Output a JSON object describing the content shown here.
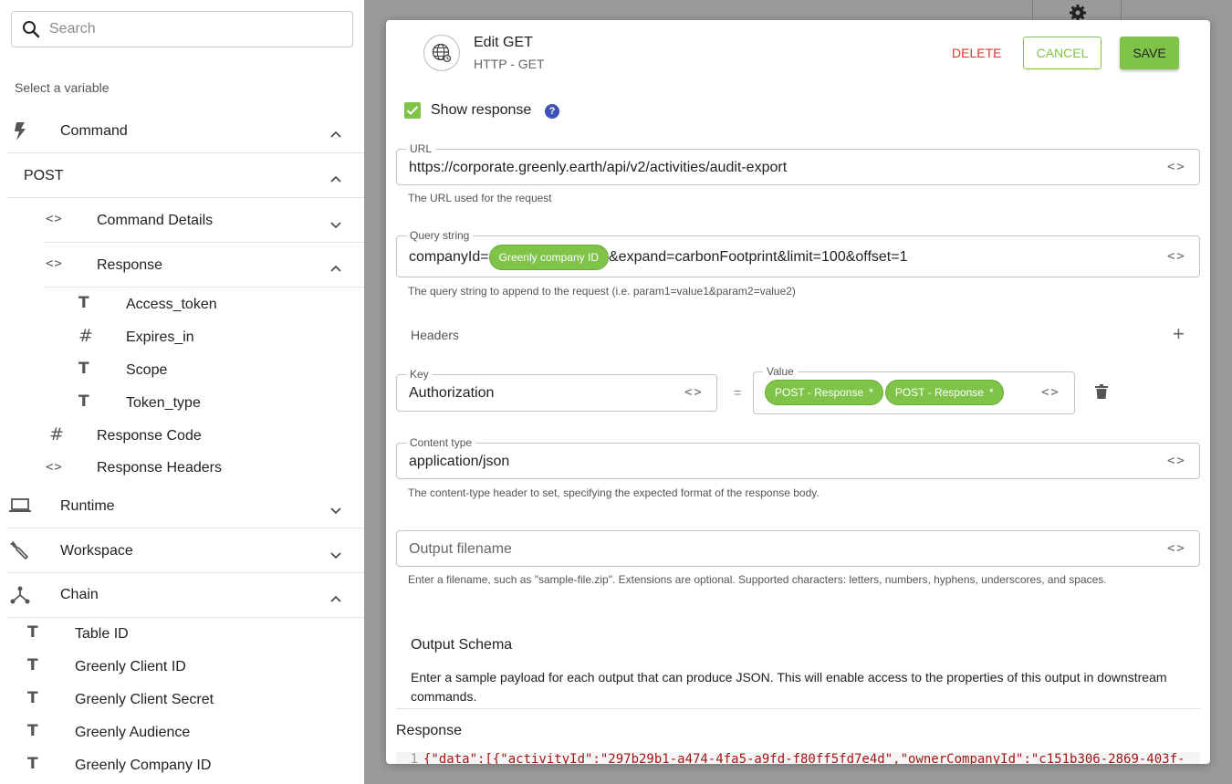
{
  "sidebar": {
    "search_placeholder": "Search",
    "select_label": "Select a variable",
    "command": {
      "label": "Command"
    },
    "post": {
      "label": "POST"
    },
    "command_details": {
      "label": "Command Details"
    },
    "response": {
      "label": "Response"
    },
    "response_fields": [
      {
        "type": "T",
        "label": "Access_token"
      },
      {
        "type": "#",
        "label": "Expires_in"
      },
      {
        "type": "T",
        "label": "Scope"
      },
      {
        "type": "T",
        "label": "Token_type"
      }
    ],
    "response_code": {
      "label": "Response Code"
    },
    "response_headers": {
      "label": "Response Headers"
    },
    "runtime": {
      "label": "Runtime"
    },
    "workspace": {
      "label": "Workspace"
    },
    "chain": {
      "label": "Chain"
    },
    "chain_items": [
      {
        "type": "T",
        "label": "Table ID"
      },
      {
        "type": "T",
        "label": "Greenly Client ID"
      },
      {
        "type": "T",
        "label": "Greenly Client Secret"
      },
      {
        "type": "T",
        "label": "Greenly Audience"
      },
      {
        "type": "T",
        "label": "Greenly Company ID"
      }
    ]
  },
  "modal": {
    "title": "Edit GET",
    "subtitle": "HTTP - GET",
    "delete_label": "DELETE",
    "cancel_label": "CANCEL",
    "save_label": "SAVE",
    "show_response_label": "Show response",
    "show_response_checked": true,
    "help_glyph": "?",
    "url": {
      "label": "URL",
      "value": "https://corporate.greenly.earth/api/v2/activities/audit-export",
      "helper": "The URL used for the request"
    },
    "query": {
      "label": "Query string",
      "prefix": "companyId=",
      "chip": "Greenly company ID",
      "suffix": "&expand=carbonFootprint&limit=100&offset=1",
      "helper": "The query string to append to the request (i.e. param1=value1&param2=value2)"
    },
    "headers": {
      "label": "Headers",
      "key_label": "Key",
      "key_value": "Authorization",
      "equals": "=",
      "value_label": "Value",
      "value_chips": [
        "POST - Response",
        "POST - Response"
      ],
      "chip_star": "*"
    },
    "content_type": {
      "label": "Content type",
      "value": "application/json",
      "helper": "The content-type header to set, specifying the expected format of the response body."
    },
    "output_filename": {
      "placeholder": "Output filename",
      "helper": "Enter a filename, such as \"sample-file.zip\". Extensions are optional. Supported characters: letters, numbers, hyphens, underscores, and spaces."
    },
    "output_schema": {
      "title": "Output Schema",
      "description": "Enter a sample payload for each output that can produce JSON. This will enable access to the properties of this output in downstream commands.",
      "response_label": "Response",
      "line_number": "1",
      "code": "{\"data\":[{\"activityId\":\"297b29b1-a474-4fa5-a9fd-f80ff5fd7e4d\",\"ownerCompanyId\":\"c151b306-2869-403f-"
    }
  },
  "colors": {
    "accent_green": "#7fc449",
    "delete_red": "#e0342a",
    "help_blue": "#3f51b5",
    "backdrop": "#9a9a9a"
  }
}
